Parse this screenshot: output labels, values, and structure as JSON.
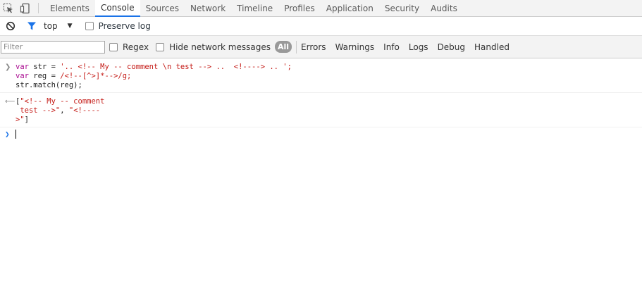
{
  "tabs": [
    "Elements",
    "Console",
    "Sources",
    "Network",
    "Timeline",
    "Profiles",
    "Application",
    "Security",
    "Audits"
  ],
  "selected_tab": "Console",
  "toolbar": {
    "context": "top",
    "preserve_log": "Preserve log"
  },
  "filterbar": {
    "placeholder": "Filter",
    "regex": "Regex",
    "hide_network": "Hide network messages",
    "all": "All",
    "levels": [
      "Errors",
      "Warnings",
      "Info",
      "Logs",
      "Debug",
      "Handled"
    ]
  },
  "console": {
    "input_lines": [
      {
        "kw": "var",
        "name": " str = ",
        "value": "'.. <!-- My -- comment \\n test --> ..  <!----> .. ';"
      },
      {
        "kw": "var",
        "name": " reg = ",
        "value": "/<!--[^>]*-->/g;"
      },
      {
        "kw": "",
        "name": "str.match(reg);",
        "value": ""
      }
    ],
    "result": {
      "open": "[",
      "item1_line1": "\"<!-- My -- comment",
      "item1_line2": " test -->\"",
      "separator": ", ",
      "item2_line1": "\"<!----",
      "item2_line2": ">\"",
      "close": "]"
    }
  },
  "colors": {
    "accent": "#1a73e8",
    "string": "#c41a16",
    "keyword": "#aa0d91"
  }
}
